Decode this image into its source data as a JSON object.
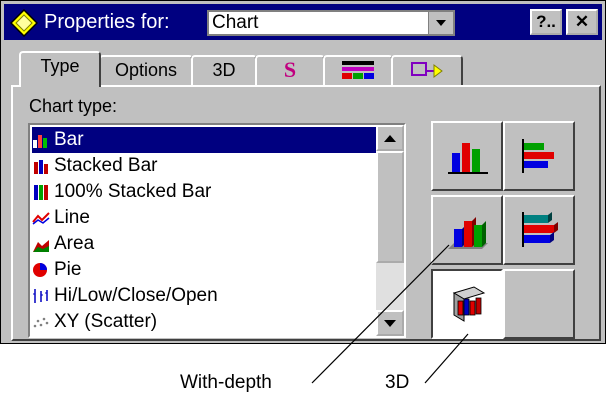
{
  "titlebar": {
    "label": "Properties for:",
    "selected_object": "Chart",
    "help_button": "?..",
    "close_button": "✕"
  },
  "tabs": [
    {
      "label": "Type",
      "active": true
    },
    {
      "label": "Options",
      "active": false
    },
    {
      "label": "3D",
      "active": false
    },
    {
      "label": "S",
      "icon": "font-style-icon",
      "active": false
    },
    {
      "label": "",
      "icon": "color-pattern-icon",
      "active": false
    },
    {
      "label": "",
      "icon": "line-marker-icon",
      "active": false
    }
  ],
  "chart_type_label": "Chart type:",
  "chart_types": [
    {
      "label": "Bar",
      "icon": "bar-chart-icon",
      "selected": true
    },
    {
      "label": "Stacked Bar",
      "icon": "stacked-bar-icon",
      "selected": false
    },
    {
      "label": "100% Stacked Bar",
      "icon": "percent-stacked-bar-icon",
      "selected": false
    },
    {
      "label": "Line",
      "icon": "line-chart-icon",
      "selected": false
    },
    {
      "label": "Area",
      "icon": "area-chart-icon",
      "selected": false
    },
    {
      "label": "Pie",
      "icon": "pie-chart-icon",
      "selected": false
    },
    {
      "label": "Hi/Low/Close/Open",
      "icon": "hi-low-icon",
      "selected": false
    },
    {
      "label": "XY (Scatter)",
      "icon": "scatter-icon",
      "selected": false
    }
  ],
  "style_buttons": [
    {
      "name": "vertical-bar-style",
      "icon": "vertical-bar-icon",
      "pressed": false
    },
    {
      "name": "horizontal-bar-style",
      "icon": "horizontal-bar-icon",
      "pressed": false
    },
    {
      "name": "with-depth-vertical-style",
      "icon": "depth-vertical-bar-icon",
      "pressed": false
    },
    {
      "name": "with-depth-horizontal-style",
      "icon": "depth-horizontal-bar-icon",
      "pressed": false
    },
    {
      "name": "3d-style",
      "icon": "3d-bar-icon",
      "pressed": true
    }
  ],
  "callouts": {
    "with_depth": "With-depth",
    "three_d": "3D"
  },
  "colors": {
    "titlebar": "#000080",
    "selection": "#000080",
    "face": "#c0c0c0"
  }
}
